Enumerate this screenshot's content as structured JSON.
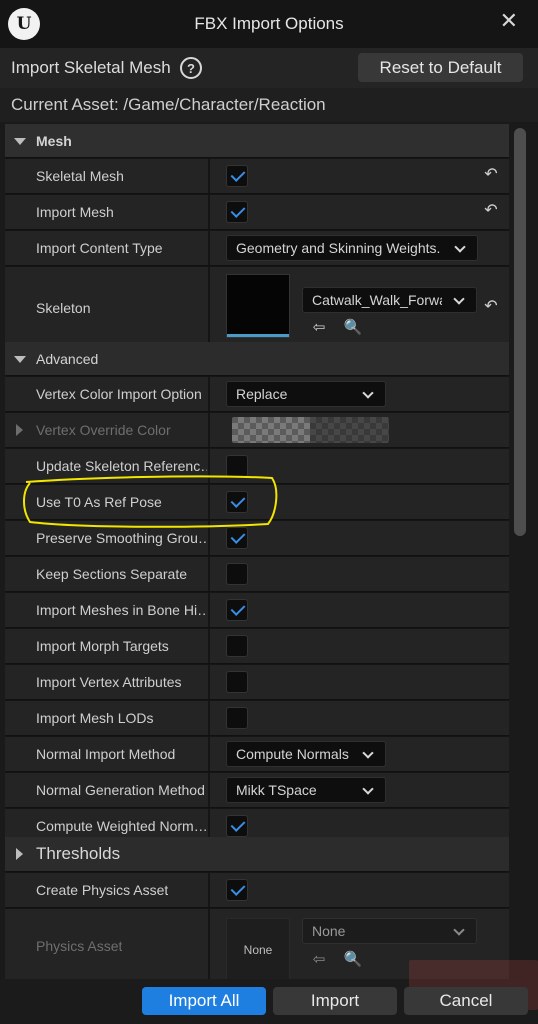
{
  "window": {
    "title": "FBX Import Options",
    "close_glyph": "✕",
    "logo_glyph": "U"
  },
  "header": {
    "title": "Import Skeletal Mesh",
    "help_glyph": "?",
    "reset_label": "Reset to Default"
  },
  "asset": {
    "label": "Current Asset:  /Game/Character/Reaction"
  },
  "categories": {
    "mesh": "Mesh",
    "advanced": "Advanced",
    "thresholds": "Thresholds"
  },
  "rows": {
    "skeletal_mesh": {
      "label": "Skeletal Mesh",
      "checked": true
    },
    "import_mesh": {
      "label": "Import Mesh",
      "checked": true
    },
    "import_content_type": {
      "label": "Import Content Type",
      "value": "Geometry and Skinning Weights."
    },
    "skeleton": {
      "label": "Skeleton",
      "value": "Catwalk_Walk_Forwa"
    },
    "vertex_color_import_option": {
      "label": "Vertex Color Import Option",
      "value": "Replace"
    },
    "vertex_override_color": {
      "label": "Vertex Override Color"
    },
    "update_skeleton_reference": {
      "label": "Update Skeleton Referenc…",
      "checked": false
    },
    "use_t0_as_ref_pose": {
      "label": "Use T0 As Ref Pose",
      "checked": true
    },
    "preserve_smoothing_groups": {
      "label": "Preserve Smoothing Grou…",
      "checked": true
    },
    "keep_sections_separate": {
      "label": "Keep Sections Separate",
      "checked": false
    },
    "import_meshes_in_bone_hierarchy": {
      "label": "Import Meshes in Bone Hi…",
      "checked": true
    },
    "import_morph_targets": {
      "label": "Import Morph Targets",
      "checked": false
    },
    "import_vertex_attributes": {
      "label": "Import Vertex Attributes",
      "checked": false
    },
    "import_mesh_lods": {
      "label": "Import Mesh LODs",
      "checked": false
    },
    "normal_import_method": {
      "label": "Normal Import Method",
      "value": "Compute Normals"
    },
    "normal_generation_method": {
      "label": "Normal Generation Method",
      "value": "Mikk TSpace"
    },
    "compute_weighted_normals": {
      "label": "Compute Weighted Norm…",
      "checked": true
    },
    "create_physics_asset": {
      "label": "Create Physics Asset",
      "checked": true
    },
    "physics_asset": {
      "label": "Physics Asset",
      "value": "None",
      "thumb_text": "None"
    }
  },
  "icons": {
    "reset_to_default": "↶",
    "browse": "⇦",
    "find_in_browser": "🔍"
  },
  "footer": {
    "import_all": "Import All",
    "import": "Import",
    "cancel": "Cancel"
  },
  "colors": {
    "accent": "#1f7fe0",
    "check": "#3a8ee6",
    "highlight": "#f2e600"
  }
}
